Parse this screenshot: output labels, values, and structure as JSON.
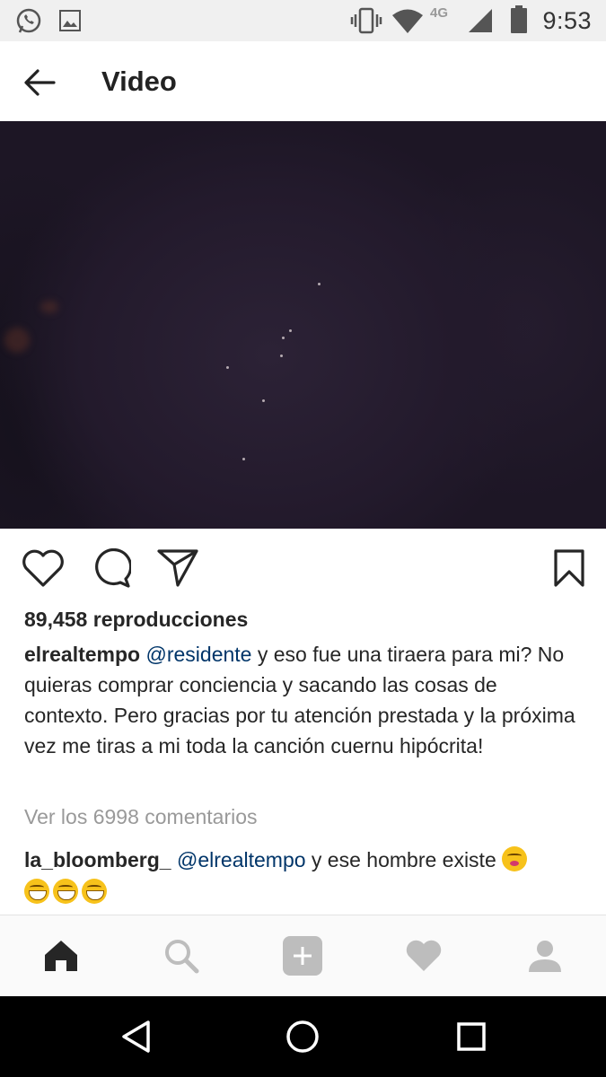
{
  "status_bar": {
    "time": "9:53",
    "network": "4G",
    "icons": [
      "whatsapp-icon",
      "gallery-icon",
      "vibrate-icon",
      "wifi-icon",
      "signal-icon",
      "battery-icon"
    ]
  },
  "app_bar": {
    "title": "Video",
    "back_icon": "arrow-back-icon"
  },
  "post": {
    "views": "89,458 reproducciones",
    "caption": {
      "username": "elrealtempo",
      "mention": "@residente",
      "text": " y eso fue una tiraera para mi? No quieras comprar conciencia y sacando las cosas de contexto. Pero gracias por tu atención prestada y la próxima vez me tiras a mi toda la canción cuernu hipócrita!"
    },
    "view_comments": "Ver los 6998 comentarios",
    "comment": {
      "username": "la_bloomberg_",
      "mention": "@elrealtempo",
      "text": " y ese hombre existe "
    }
  },
  "actions": [
    "like-icon",
    "comment-icon",
    "share-icon",
    "bookmark-icon"
  ],
  "tab_bar": [
    "home-icon",
    "search-icon",
    "add-post-icon",
    "activity-icon",
    "profile-icon"
  ],
  "nav_bar": [
    "back-triangle-icon",
    "home-circle-icon",
    "recents-square-icon"
  ],
  "colors": {
    "mention": "#003569",
    "muted": "#999999",
    "text": "#262626",
    "video_bg": "#1d1625"
  }
}
